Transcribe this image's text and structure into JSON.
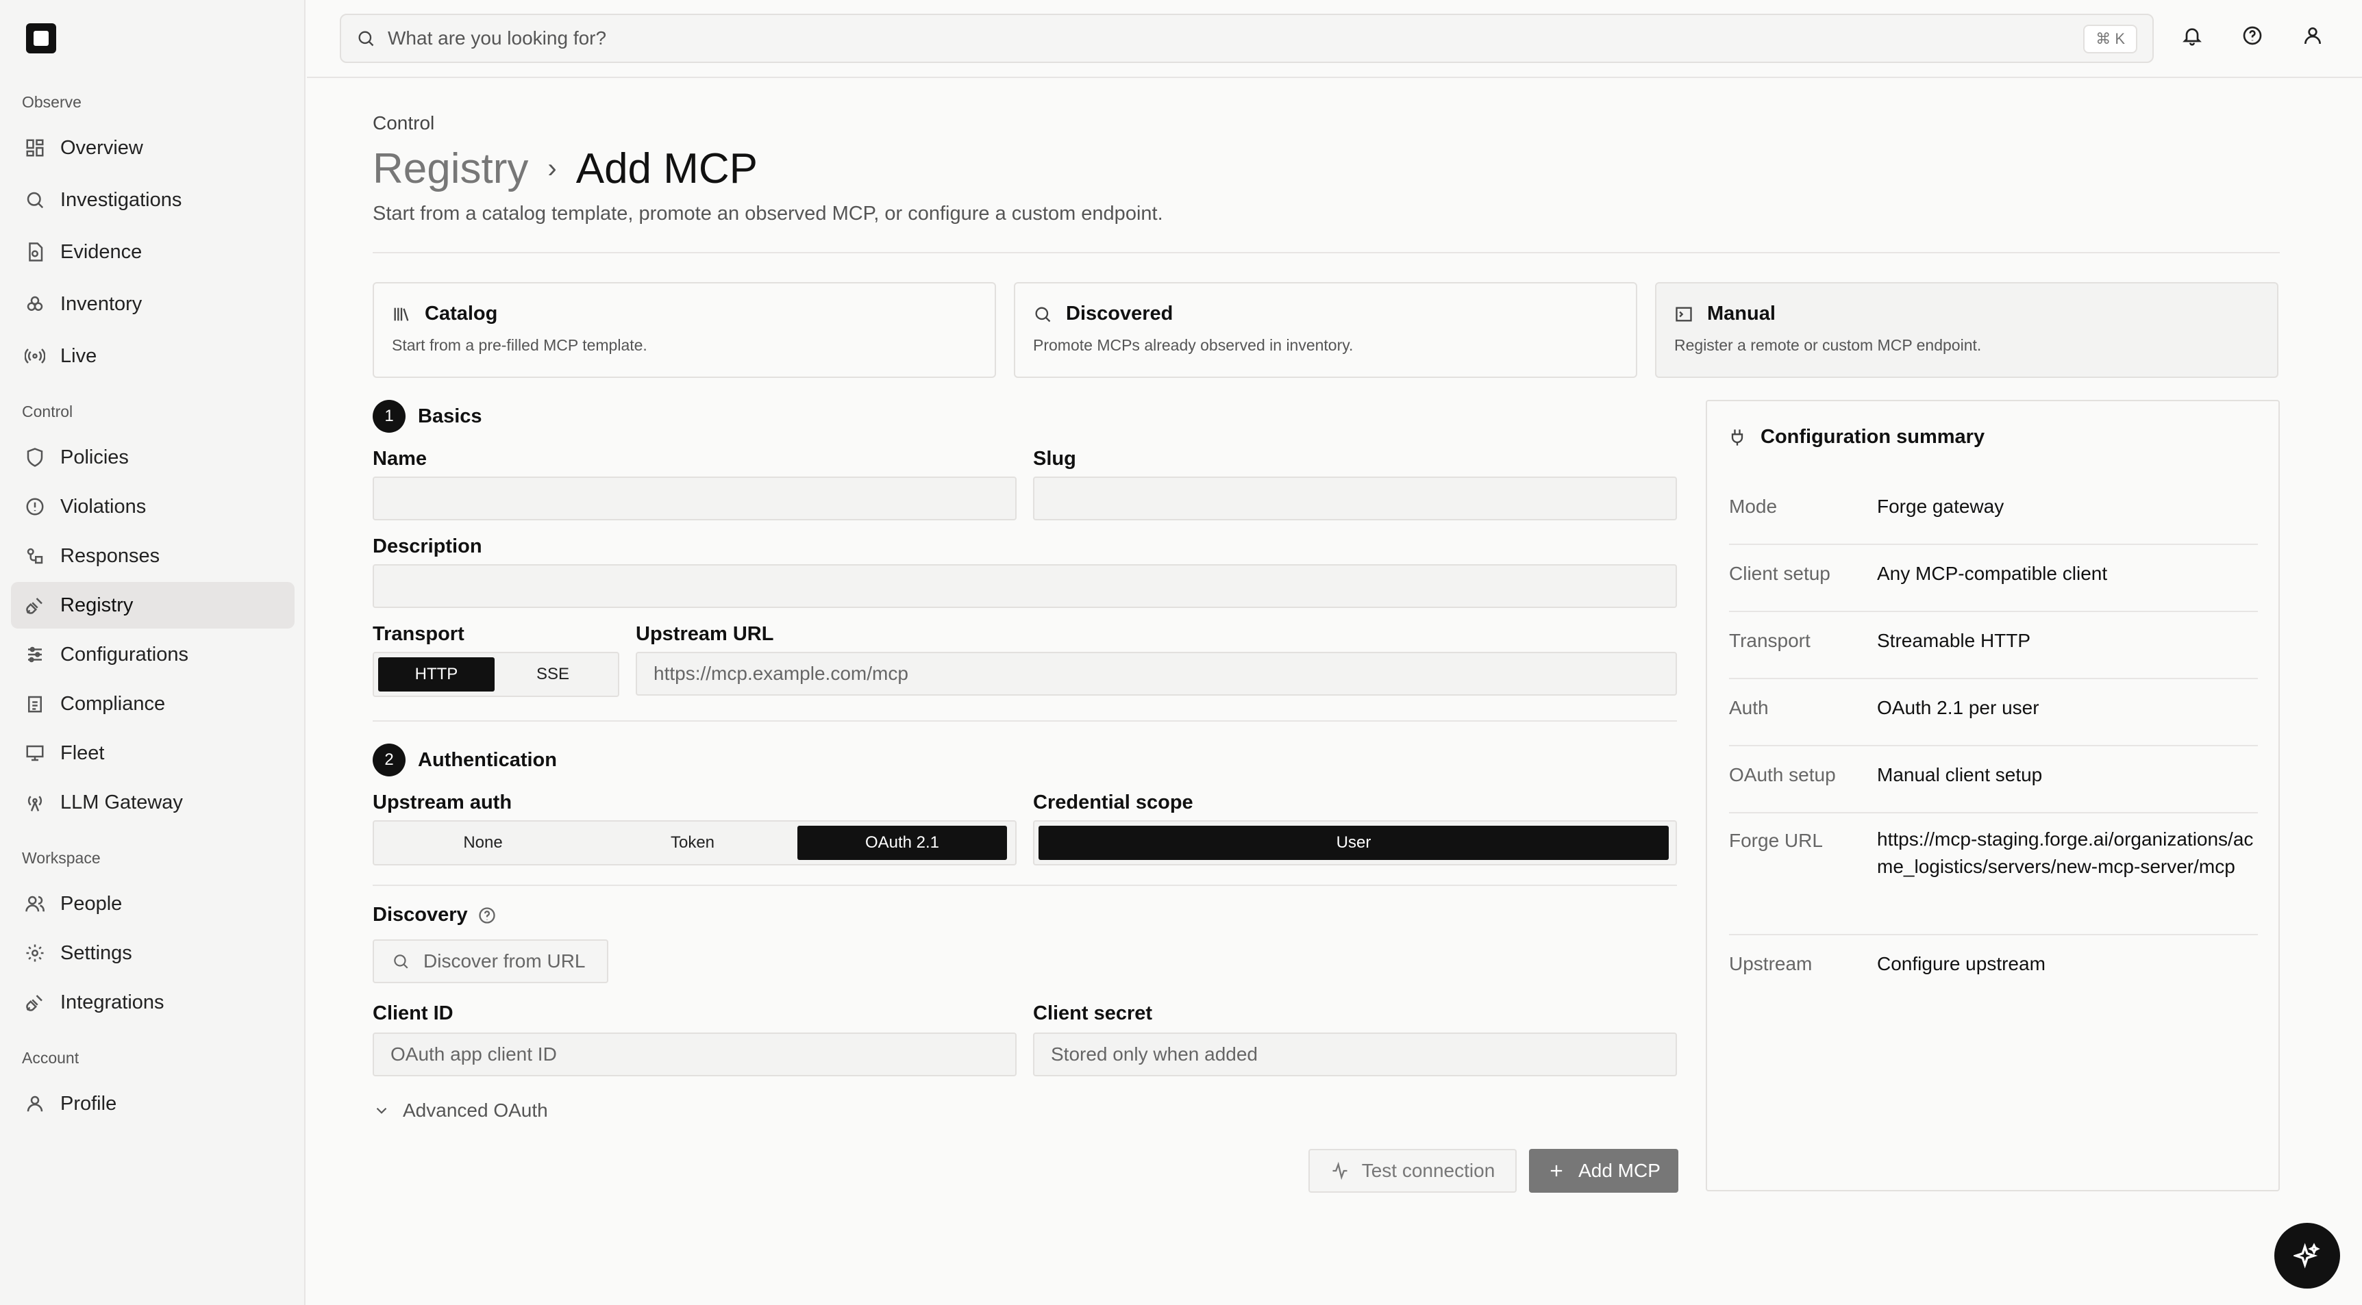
{
  "sidebar": {
    "sections": [
      {
        "title": "Observe",
        "items": [
          {
            "label": "Overview",
            "icon": "grid-icon"
          },
          {
            "label": "Investigations",
            "icon": "search-icon"
          },
          {
            "label": "Evidence",
            "icon": "file-icon"
          },
          {
            "label": "Inventory",
            "icon": "boxes-icon"
          },
          {
            "label": "Live",
            "icon": "radio-icon"
          }
        ]
      },
      {
        "title": "Control",
        "items": [
          {
            "label": "Policies",
            "icon": "shield-icon"
          },
          {
            "label": "Violations",
            "icon": "alert-circle-icon"
          },
          {
            "label": "Responses",
            "icon": "workflow-icon"
          },
          {
            "label": "Registry",
            "icon": "plug-icon",
            "active": true
          },
          {
            "label": "Configurations",
            "icon": "sliders-icon"
          },
          {
            "label": "Compliance",
            "icon": "clipboard-icon"
          },
          {
            "label": "Fleet",
            "icon": "monitor-icon"
          },
          {
            "label": "LLM Gateway",
            "icon": "antenna-icon"
          }
        ]
      },
      {
        "title": "Workspace",
        "items": [
          {
            "label": "People",
            "icon": "users-icon"
          },
          {
            "label": "Settings",
            "icon": "gear-icon"
          },
          {
            "label": "Integrations",
            "icon": "plug-icon"
          }
        ]
      },
      {
        "title": "Account",
        "items": [
          {
            "label": "Profile",
            "icon": "user-icon"
          }
        ]
      }
    ]
  },
  "topbar": {
    "search_placeholder": "What are you looking for?",
    "shortcut": "⌘ K"
  },
  "page": {
    "section": "Control",
    "breadcrumb_parent": "Registry",
    "breadcrumb_current": "Add MCP",
    "subtitle": "Start from a catalog template, promote an observed MCP, or configure a custom endpoint."
  },
  "modes": [
    {
      "title": "Catalog",
      "desc": "Start from a pre-filled MCP template.",
      "icon": "library-icon"
    },
    {
      "title": "Discovered",
      "desc": "Promote MCPs already observed in inventory.",
      "icon": "search-icon"
    },
    {
      "title": "Manual",
      "desc": "Register a remote or custom MCP endpoint.",
      "icon": "terminal-icon",
      "active": true
    }
  ],
  "basics": {
    "step": "1",
    "title": "Basics",
    "name_label": "Name",
    "name_value": "",
    "slug_label": "Slug",
    "slug_value": "",
    "description_label": "Description",
    "description_value": "",
    "transport_label": "Transport",
    "transport_options": [
      "HTTP",
      "SSE"
    ],
    "transport_selected": "HTTP",
    "upstream_label": "Upstream URL",
    "upstream_placeholder": "https://mcp.example.com/mcp"
  },
  "auth": {
    "step": "2",
    "title": "Authentication",
    "upstream_auth_label": "Upstream auth",
    "upstream_auth_options": [
      "None",
      "Token",
      "OAuth 2.1"
    ],
    "upstream_auth_selected": "OAuth 2.1",
    "scope_label": "Credential scope",
    "scope_options": [
      "User"
    ],
    "scope_selected": "User",
    "discovery_label": "Discovery",
    "discover_placeholder": "Discover from URL",
    "client_id_label": "Client ID",
    "client_id_placeholder": "OAuth app client ID",
    "client_secret_label": "Client secret",
    "client_secret_placeholder": "Stored only when added",
    "advanced_label": "Advanced OAuth"
  },
  "actions": {
    "test_label": "Test connection",
    "add_label": "Add MCP"
  },
  "summary": {
    "title": "Configuration summary",
    "rows": [
      {
        "key": "Mode",
        "value": "Forge gateway"
      },
      {
        "key": "Client setup",
        "value": "Any MCP-compatible client"
      },
      {
        "key": "Transport",
        "value": "Streamable HTTP"
      },
      {
        "key": "Auth",
        "value": "OAuth 2.1 per user"
      },
      {
        "key": "OAuth setup",
        "value": "Manual client setup"
      },
      {
        "key": "Forge URL",
        "value": "https://mcp-staging.forge.ai/organizations/acme_logistics/servers/new-mcp-server/mcp"
      },
      {
        "key": "Upstream",
        "value": "Configure upstream"
      }
    ]
  }
}
